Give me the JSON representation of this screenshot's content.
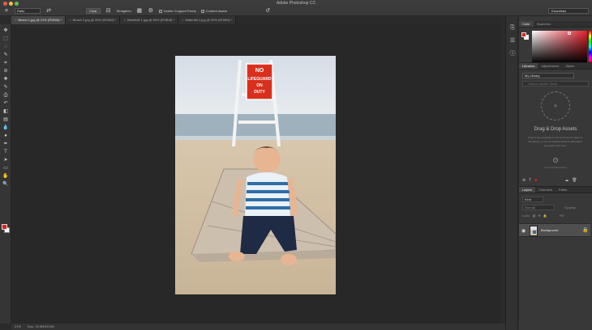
{
  "app": {
    "title": "Adobe Photoshop CC"
  },
  "options_bar": {
    "tool_icon": "crop-icon",
    "ratio_select": "Ratio",
    "clear_button": "Clear",
    "straighten_label": "Straighten",
    "delete_cropped_label": "Delete Cropped Pixels",
    "content_aware_label": "Content-Aware",
    "workspace_select": "Essentials"
  },
  "document_tabs": [
    {
      "label": "Beach 1.jpg @ 21% (RGB/8) *",
      "active": true
    },
    {
      "label": "Beach 2.jpg @ 25% (RGB/8) *",
      "active": false
    },
    {
      "label": "Waterfall 1.jpg @ 50% (RGB/8) *",
      "active": false
    },
    {
      "label": "Waterfall 2.jpg @ 50% (RGB/8) *",
      "active": false
    }
  ],
  "tools": [
    "move-icon",
    "marquee-icon",
    "lasso-icon",
    "quick-select-icon",
    "crop-icon",
    "eyedropper-icon",
    "healing-icon",
    "brush-icon",
    "clone-stamp-icon",
    "history-brush-icon",
    "eraser-icon",
    "gradient-icon",
    "blur-icon",
    "dodge-icon",
    "pen-icon",
    "type-icon",
    "path-select-icon",
    "rectangle-icon",
    "hand-icon",
    "zoom-icon"
  ],
  "colors": {
    "foreground": "#d8241c",
    "background": "#ffffff",
    "workspace_bg": "#282828",
    "panel_bg": "#383838"
  },
  "photo": {
    "sign_line1": "NO",
    "sign_line2": "LIFEGUARD",
    "sign_line3": "ON",
    "sign_line4": "DUTY"
  },
  "statusbar": {
    "zoom": "21%",
    "doc_size": "Doc: 19.9M/19.9M"
  },
  "color_panel": {
    "tab_color": "Color",
    "tab_swatches": "Swatches"
  },
  "libraries_panel": {
    "tab_libraries": "Libraries",
    "tab_adjustments": "Adjustments",
    "tab_styles": "Styles",
    "library_select": "My Library",
    "search_placeholder": "Search Adobe Stock",
    "drag_drop_title": "Drag & Drop Assets",
    "drag_drop_body": "Drag & drop anything in your document to add it to this library, or use the buttons below to add colors, text styles and more.",
    "footer_text": "Stock & Marketplace"
  },
  "layers_panel": {
    "tab_layers": "Layers",
    "tab_channels": "Channels",
    "tab_paths": "Paths",
    "filter_label": "Kind",
    "blend_mode": "Normal",
    "opacity_label": "Opacity:",
    "lock_label": "Lock:",
    "fill_label": "Fill:",
    "layer_name": "Background"
  }
}
